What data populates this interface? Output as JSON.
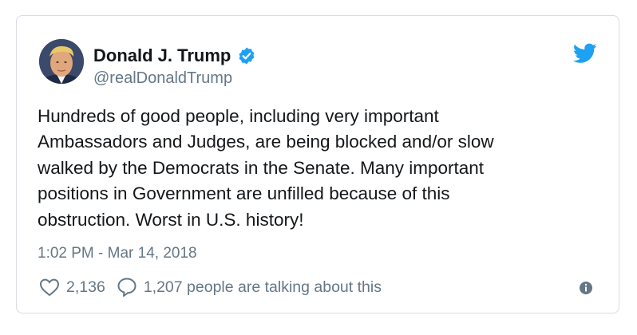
{
  "author": {
    "display_name": "Donald J. Trump",
    "handle": "@realDonaldTrump",
    "verified": true,
    "avatar_icon": "profile-photo"
  },
  "tweet": {
    "text_lines": [
      "Hundreds of good people, including very important",
      "Ambassadors and Judges, are being blocked and/or slow",
      "walked by the Democrats in the Senate. Many important",
      "positions in Government are unfilled because of this",
      "obstruction. Worst in U.S. history!"
    ],
    "timestamp": "1:02 PM - Mar 14, 2018"
  },
  "stats": {
    "likes": "2,136",
    "talking": "1,207 people are talking about this"
  },
  "icons": {
    "brand": "twitter-bird-icon",
    "verified": "verified-badge-icon",
    "like": "heart-icon",
    "reply": "speech-bubble-icon",
    "info": "info-icon"
  },
  "colors": {
    "twitter_blue": "#1da1f2",
    "text": "#14171a",
    "secondary_text": "#657786",
    "border": "#d8dde2"
  }
}
